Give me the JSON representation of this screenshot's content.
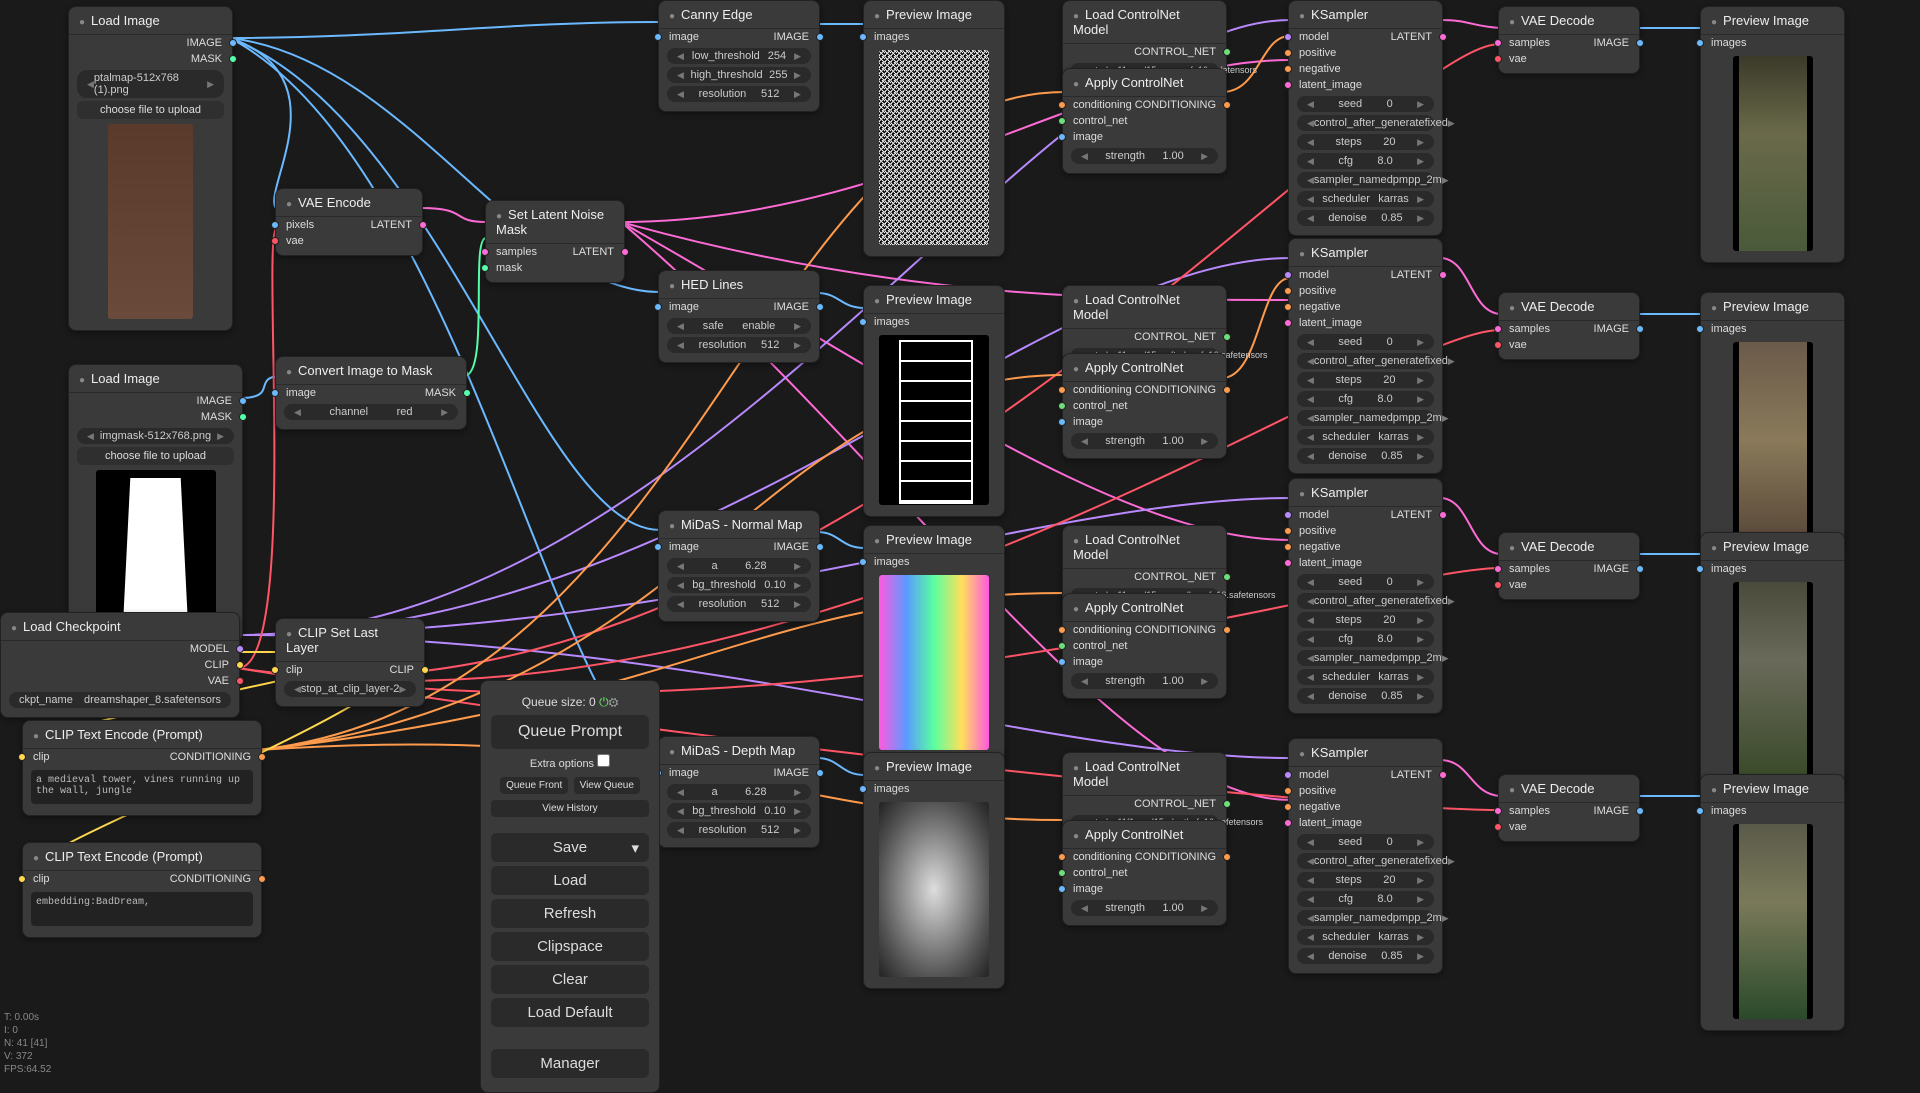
{
  "labels": {
    "chooseFile": "choose file to upload",
    "image": "image",
    "images": "images",
    "IMAGE": "IMAGE",
    "preview": "Preview Image",
    "loadCNet": "Load ControlNet Model",
    "applyCNet": "Apply ControlNet",
    "CONTROL_NET": "CONTROL_NET",
    "CONDITIONING": "CONDITIONING",
    "conditioning": "conditioning",
    "control_net": "control_net",
    "strength": "strength",
    "vaeDecode": "VAE Decode",
    "samples": "samples",
    "vae": "vae"
  },
  "nodes": {
    "loadImage1": {
      "title": "Load Image",
      "outImage": "IMAGE",
      "outMask": "MASK",
      "file": "ptalmap-512x768 (1).png"
    },
    "loadImage2": {
      "title": "Load Image",
      "outImage": "IMAGE",
      "outMask": "MASK",
      "file": "imgmask-512x768.png"
    },
    "loadCkpt": {
      "title": "Load Checkpoint",
      "outModel": "MODEL",
      "outClip": "CLIP",
      "outVae": "VAE",
      "fieldLabel": "ckpt_name",
      "file": "dreamshaper_8.safetensors"
    },
    "clipLayer": {
      "title": "CLIP Set Last Layer",
      "inClip": "clip",
      "outClip": "CLIP",
      "label": "stop_at_clip_layer",
      "value": "-2"
    },
    "clipPos": {
      "title": "CLIP Text Encode (Prompt)",
      "inClip": "clip",
      "outCond": "CONDITIONING",
      "text": "a medieval tower, vines running up the wall, jungle"
    },
    "clipNeg": {
      "title": "CLIP Text Encode (Prompt)",
      "inClip": "clip",
      "outCond": "CONDITIONING",
      "text": "embedding:BadDream,"
    },
    "vaeEnc": {
      "title": "VAE Encode",
      "inPixels": "pixels",
      "inVae": "vae",
      "outLatent": "LATENT"
    },
    "imgToMask": {
      "title": "Convert Image to Mask",
      "inImage": "image",
      "outMask": "MASK",
      "label": "channel",
      "value": "red"
    },
    "noiseMask": {
      "title": "Set Latent Noise Mask",
      "inSamples": "samples",
      "inMask": "mask",
      "outLatent": "LATENT"
    },
    "canny": {
      "title": "Canny Edge",
      "w1l": "low_threshold",
      "w1v": "254",
      "w2l": "high_threshold",
      "w2v": "255",
      "w3l": "resolution",
      "w3v": "512"
    },
    "hed": {
      "title": "HED Lines",
      "w1l": "safe",
      "w1v": "enable",
      "w2l": "resolution",
      "w2v": "512"
    },
    "midasN": {
      "title": "MiDaS - Normal Map",
      "w1l": "a",
      "w1v": "6.28",
      "w2l": "bg_threshold",
      "w2v": "0.10",
      "w3l": "resolution",
      "w3v": "512"
    },
    "midasD": {
      "title": "MiDaS - Depth Map",
      "w1l": "a",
      "w1v": "6.28",
      "w2l": "bg_threshold",
      "w2v": "0.10",
      "w3l": "resolution",
      "w3v": "512"
    },
    "cnet1": {
      "file": "control_v11p_sd15_canny_fp16.safetensors"
    },
    "cnet2": {
      "file": "control_v11p_sd15_softedge_fp16.safetensors"
    },
    "cnet3": {
      "file": "control_v11p_sd15_normalbae_fp16.safetensors"
    },
    "cnet4": {
      "file": "control_v11f1p_sd15_depth_fp16.safetensors"
    },
    "applyCNet": {
      "strength": "1.00"
    },
    "ksampler": {
      "title": "KSampler",
      "inputs": [
        "model",
        "positive",
        "negative",
        "latent_image"
      ],
      "output": "LATENT",
      "params": [
        {
          "label": "seed",
          "value": "0"
        },
        {
          "label": "control_after_generate",
          "value": "fixed"
        },
        {
          "label": "steps",
          "value": "20"
        },
        {
          "label": "cfg",
          "value": "8.0"
        },
        {
          "label": "sampler_name",
          "value": "dpmpp_2m"
        },
        {
          "label": "scheduler",
          "value": "karras"
        },
        {
          "label": "denoise",
          "value": "0.85"
        }
      ]
    }
  },
  "panel": {
    "queueSize": "Queue size: 0",
    "queuePrompt": "Queue Prompt",
    "extra": "Extra options",
    "queueFront": "Queue Front",
    "viewQueue": "View Queue",
    "viewHistory": "View History",
    "save": "Save",
    "load": "Load",
    "refresh": "Refresh",
    "clipspace": "Clipspace",
    "clear": "Clear",
    "loadDefault": "Load Default",
    "manager": "Manager"
  },
  "stats": "T: 0.00s\nI: 0\nN: 41 [41]\nV: 372\nFPS:64.52",
  "colors": {
    "image": "#6bb9ff",
    "mask": "#55ffaa",
    "latent": "#ff6bd6",
    "vae": "#ff5566",
    "model": "#b98aff",
    "clip": "#ffd84d",
    "cond": "#ff9b4d",
    "controlnet": "#6ee07a"
  }
}
